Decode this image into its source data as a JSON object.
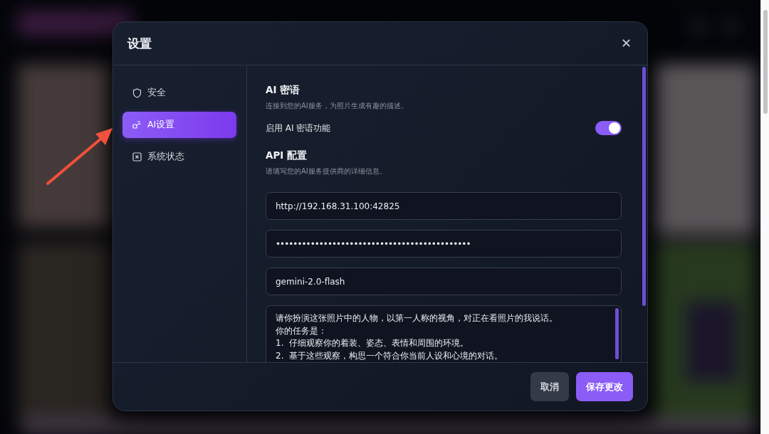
{
  "dialog": {
    "title": "设置",
    "close": "✕"
  },
  "sidebar": {
    "items": [
      {
        "label": "安全",
        "kind": "shield",
        "selected": false
      },
      {
        "label": "AI设置",
        "kind": "ai",
        "selected": true
      },
      {
        "label": "系统状态",
        "kind": "status",
        "selected": false
      }
    ]
  },
  "section": {
    "title": "AI 密语",
    "description": "连接到您的AI服务，为照片生成有趣的描述。",
    "toggle": {
      "label": "启用 AI 密语功能",
      "on": true
    }
  },
  "api": {
    "title": "API 配置",
    "description": "请填写您的AI服务提供商的详细信息。",
    "fields": [
      {
        "kind": "text",
        "value": "http://192.168.31.100:42825"
      },
      {
        "kind": "password",
        "value": "•••••••••••••••••••••••••••••••••••••••••••••"
      },
      {
        "kind": "text",
        "value": "gemini-2.0-flash"
      },
      {
        "kind": "multiline",
        "lines": [
          "请你扮演这张照片中的人物，以第一人称的视角，对正在看照片的我说话。",
          "你的任务是：",
          "1.  仔细观察你的着装、姿态、表情和周围的环境。",
          "2.  基于这些观察，构思一个符合你当前人设和心境的对话。"
        ]
      }
    ]
  },
  "buttons": [
    {
      "label": "取消",
      "kind": "secondary"
    },
    {
      "label": "保存更改",
      "kind": "primary"
    }
  ]
}
